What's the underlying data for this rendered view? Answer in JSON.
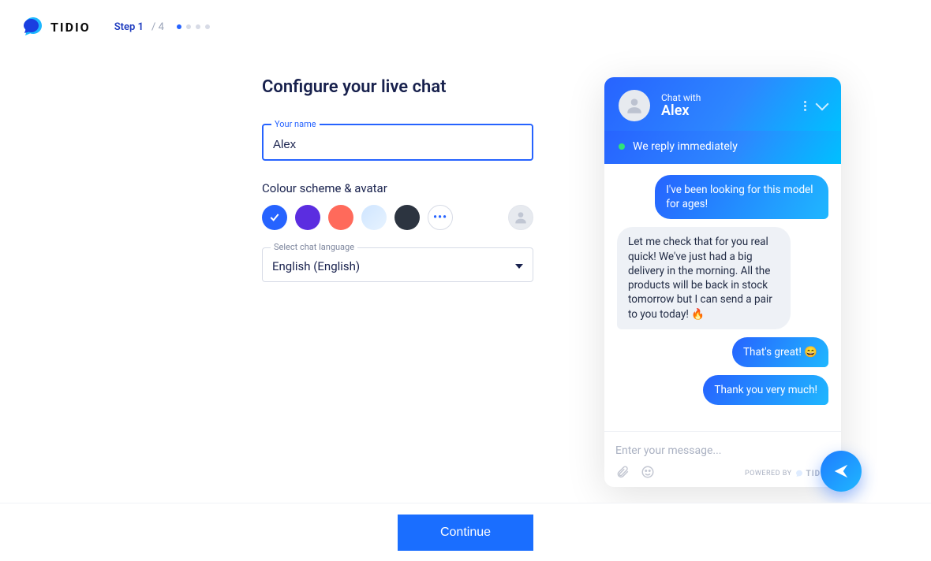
{
  "brand": "TIDIO",
  "step": {
    "current_label": "Step 1",
    "total_label": "/ 4",
    "active_index": 0,
    "total_dots": 4
  },
  "page_title": "Configure your live chat",
  "name_field": {
    "label": "Your name",
    "value": "Alex"
  },
  "colour_section_label": "Colour scheme & avatar",
  "swatches": [
    {
      "color": "#2663ff",
      "selected": true
    },
    {
      "color": "#5b2de0",
      "selected": false
    },
    {
      "color": "#ff6a5b",
      "selected": false
    },
    {
      "color": "linear-gradient(135deg,#cfe5ff,#e7f3ff)",
      "selected": false
    },
    {
      "color": "#2c3440",
      "selected": false
    }
  ],
  "swatch_more_label": "•••",
  "lang_field": {
    "label": "Select chat language",
    "value": "English (English)"
  },
  "chat": {
    "header_small": "Chat with",
    "header_name": "Alex",
    "banner": "We reply immediately",
    "messages": [
      {
        "side": "user",
        "text": "I've been looking for this model for ages!"
      },
      {
        "side": "agent",
        "text": "Let me check that for you real quick! We've just had a big delivery in the morning. All the products will be back in stock tomorrow but I can send a pair to you today! 🔥"
      },
      {
        "side": "user",
        "text": "That's great! 😄"
      },
      {
        "side": "user",
        "text": "Thank you very much!"
      }
    ],
    "composer_placeholder": "Enter your message...",
    "powered_by": "POWERED BY",
    "powered_brand": "TIDIO"
  },
  "continue_label": "Continue"
}
